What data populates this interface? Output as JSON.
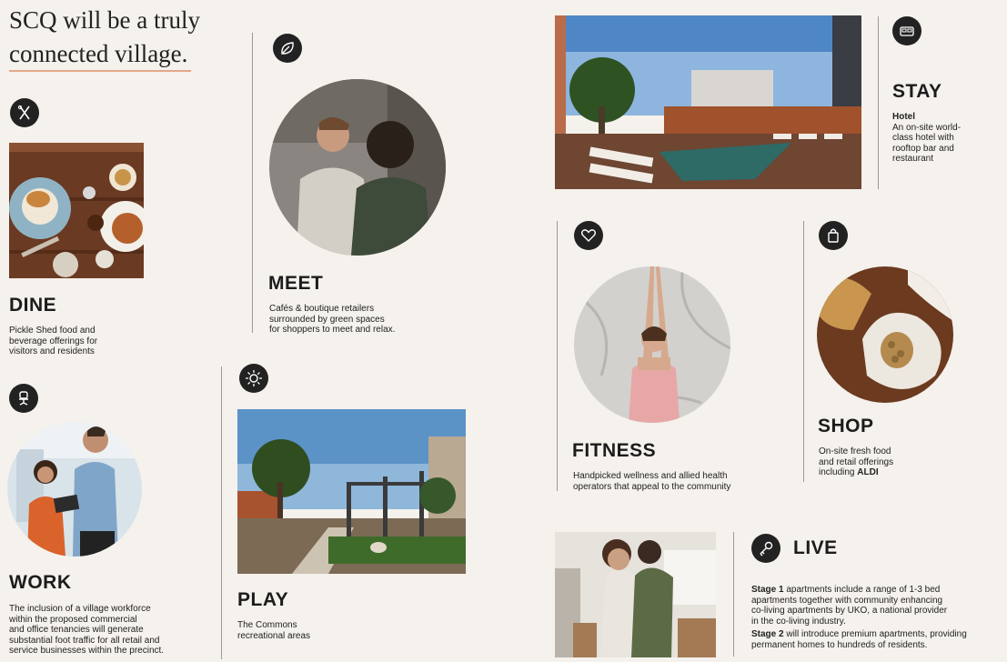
{
  "headline": {
    "line1": "SCQ will be a truly",
    "line2": "connected village."
  },
  "sections": {
    "dine": {
      "title": "DINE",
      "desc_lines": [
        "Pickle Shed food and",
        "beverage offerings for",
        "visitors and residents"
      ],
      "icon": "utensils-icon"
    },
    "work": {
      "title": "WORK",
      "desc_lines": [
        "The inclusion of a village workforce",
        "within the proposed commercial",
        "and office tenancies will generate",
        "substantial foot traffic for all retail and",
        "service businesses within the precinct."
      ],
      "icon": "desk-chair-icon"
    },
    "meet": {
      "title": "MEET",
      "desc_lines": [
        "Cafés & boutique retailers",
        "surrounded by green spaces",
        "for shoppers to meet and relax."
      ],
      "icon": "leaf-icon"
    },
    "play": {
      "title": "PLAY",
      "desc_lines": [
        "The Commons",
        "recreational areas"
      ],
      "icon": "sun-icon"
    },
    "stay": {
      "title": "STAY",
      "subtitle": "Hotel",
      "desc_lines": [
        "An on-site world-",
        "class hotel with",
        "rooftop bar and",
        "restaurant"
      ],
      "icon": "bed-icon"
    },
    "fitness": {
      "title": "FITNESS",
      "desc_lines": [
        "Handpicked wellness and allied health",
        "operators that appeal to the community"
      ],
      "icon": "heart-icon"
    },
    "shop": {
      "title": "SHOP",
      "desc_lines": [
        "On-site fresh food",
        "and retail offerings"
      ],
      "desc_last_prefix": "including ",
      "desc_last_bold": "ALDI",
      "icon": "shopping-bag-icon"
    },
    "live": {
      "title": "LIVE",
      "p1_bold": "Stage 1",
      "p1_lines": [
        " apartments include a range of 1-3 bed",
        "apartments together with community enhancing",
        "co-living apartments by UKO, a national provider",
        "in the co-living industry."
      ],
      "p2_bold": "Stage 2",
      "p2_lines": [
        " will introduce premium apartments, providing",
        "permanent homes to hundreds of residents."
      ],
      "icon": "keys-icon"
    }
  },
  "colors": {
    "background": "#f5f1ec",
    "accent_rule": "#e4a98a",
    "icon_bg": "#222222",
    "divider": "#9a9a9a"
  }
}
